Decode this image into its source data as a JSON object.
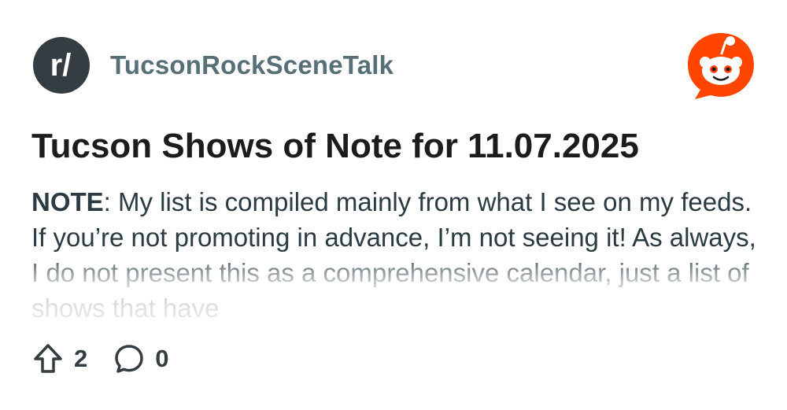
{
  "subreddit": {
    "avatar_text": "r/",
    "name": "TucsonRockSceneTalk"
  },
  "logo": "reddit-snoo-icon",
  "post": {
    "title": "Tucson Shows of Note for 11.07.2025",
    "body_label": "NOTE",
    "body_text": ": My list is compiled mainly from what I see on my feeds. If you’re not promoting in advance, I’m not seeing it! As always, I do not present this as a comprehensive calendar, just a list of shows that have"
  },
  "stats": {
    "upvotes": "2",
    "comments": "0"
  },
  "colors": {
    "avatar_bg": "#333d42",
    "subreddit_name": "#576f76",
    "title": "#1c1c1c",
    "body": "#2a3c42",
    "reddit_orange": "#ff4500"
  }
}
